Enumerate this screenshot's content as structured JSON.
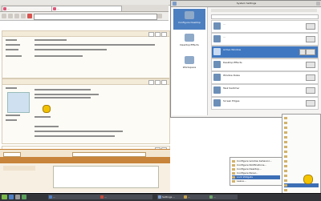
{
  "browser": {
    "tabs": [
      {
        "label": "..."
      },
      {
        "label": "..."
      }
    ],
    "url": ""
  },
  "forum": {
    "reply_button": "",
    "quote_button": ""
  },
  "settings_window": {
    "title": "System Settings",
    "sidebar": [
      {
        "label": "Configure Desktop"
      },
      {
        "label": "Desktop Effects"
      },
      {
        "label": "Workspace"
      }
    ],
    "rows": [
      {
        "title": "...",
        "desc": "..."
      },
      {
        "title": "...",
        "desc": "..."
      },
      {
        "title": "Active Window",
        "desc": "..."
      },
      {
        "title": "Desktop Effects",
        "desc": "..."
      },
      {
        "title": "Window Rules",
        "desc": "..."
      },
      {
        "title": "Task Switcher",
        "desc": "..."
      },
      {
        "title": "Screen Edges",
        "desc": "..."
      }
    ]
  },
  "context_menu": {
    "items": [
      "Configure window behavior...",
      "Configure Notifications...",
      "Configure Desktop...",
      "Configure Panel...",
      "Lock Widgets",
      "Leave..."
    ]
  },
  "tray_menu": {
    "items": [
      "",
      "",
      "",
      "",
      "",
      "",
      "",
      "",
      "",
      "",
      "",
      "",
      "",
      "",
      "",
      "",
      ""
    ]
  },
  "taskbar": {
    "tasks": [
      {
        "label": "..."
      },
      {
        "label": "..."
      },
      {
        "label": "Settings ..."
      },
      {
        "label": "..."
      },
      {
        "label": "..."
      }
    ],
    "clock": ""
  }
}
